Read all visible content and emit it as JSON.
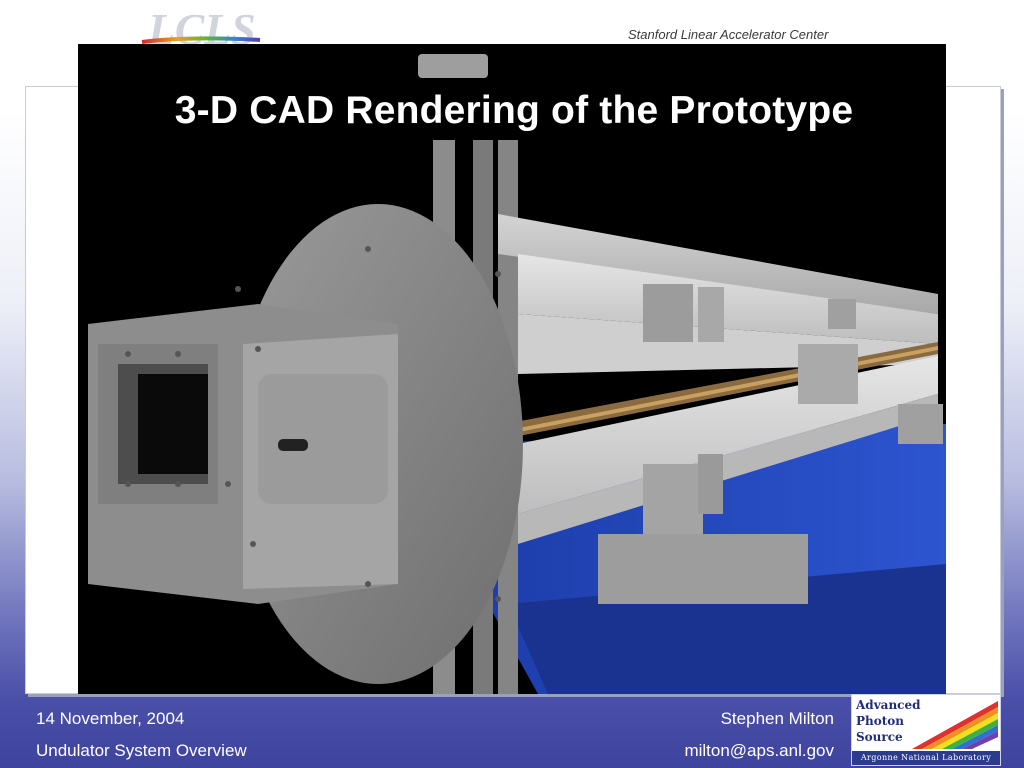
{
  "header": {
    "logo_text": "LCLS",
    "organization": "Stanford Linear Accelerator Center"
  },
  "slide": {
    "title": "3-D CAD Rendering of the Prototype"
  },
  "footer": {
    "date": "14 November, 2004",
    "subject": "Undulator System Overview",
    "presenter": "Stephen Milton",
    "email": "milton@aps.anl.gov"
  },
  "aps_logo": {
    "line1": "Advanced",
    "line2": "Photon",
    "line3": "Source",
    "lab": "Argonne National Laboratory"
  },
  "colors": {
    "footer_blue": "#3e439e",
    "logo_blue": "#1f2d7a",
    "title_bg": "#000000"
  }
}
